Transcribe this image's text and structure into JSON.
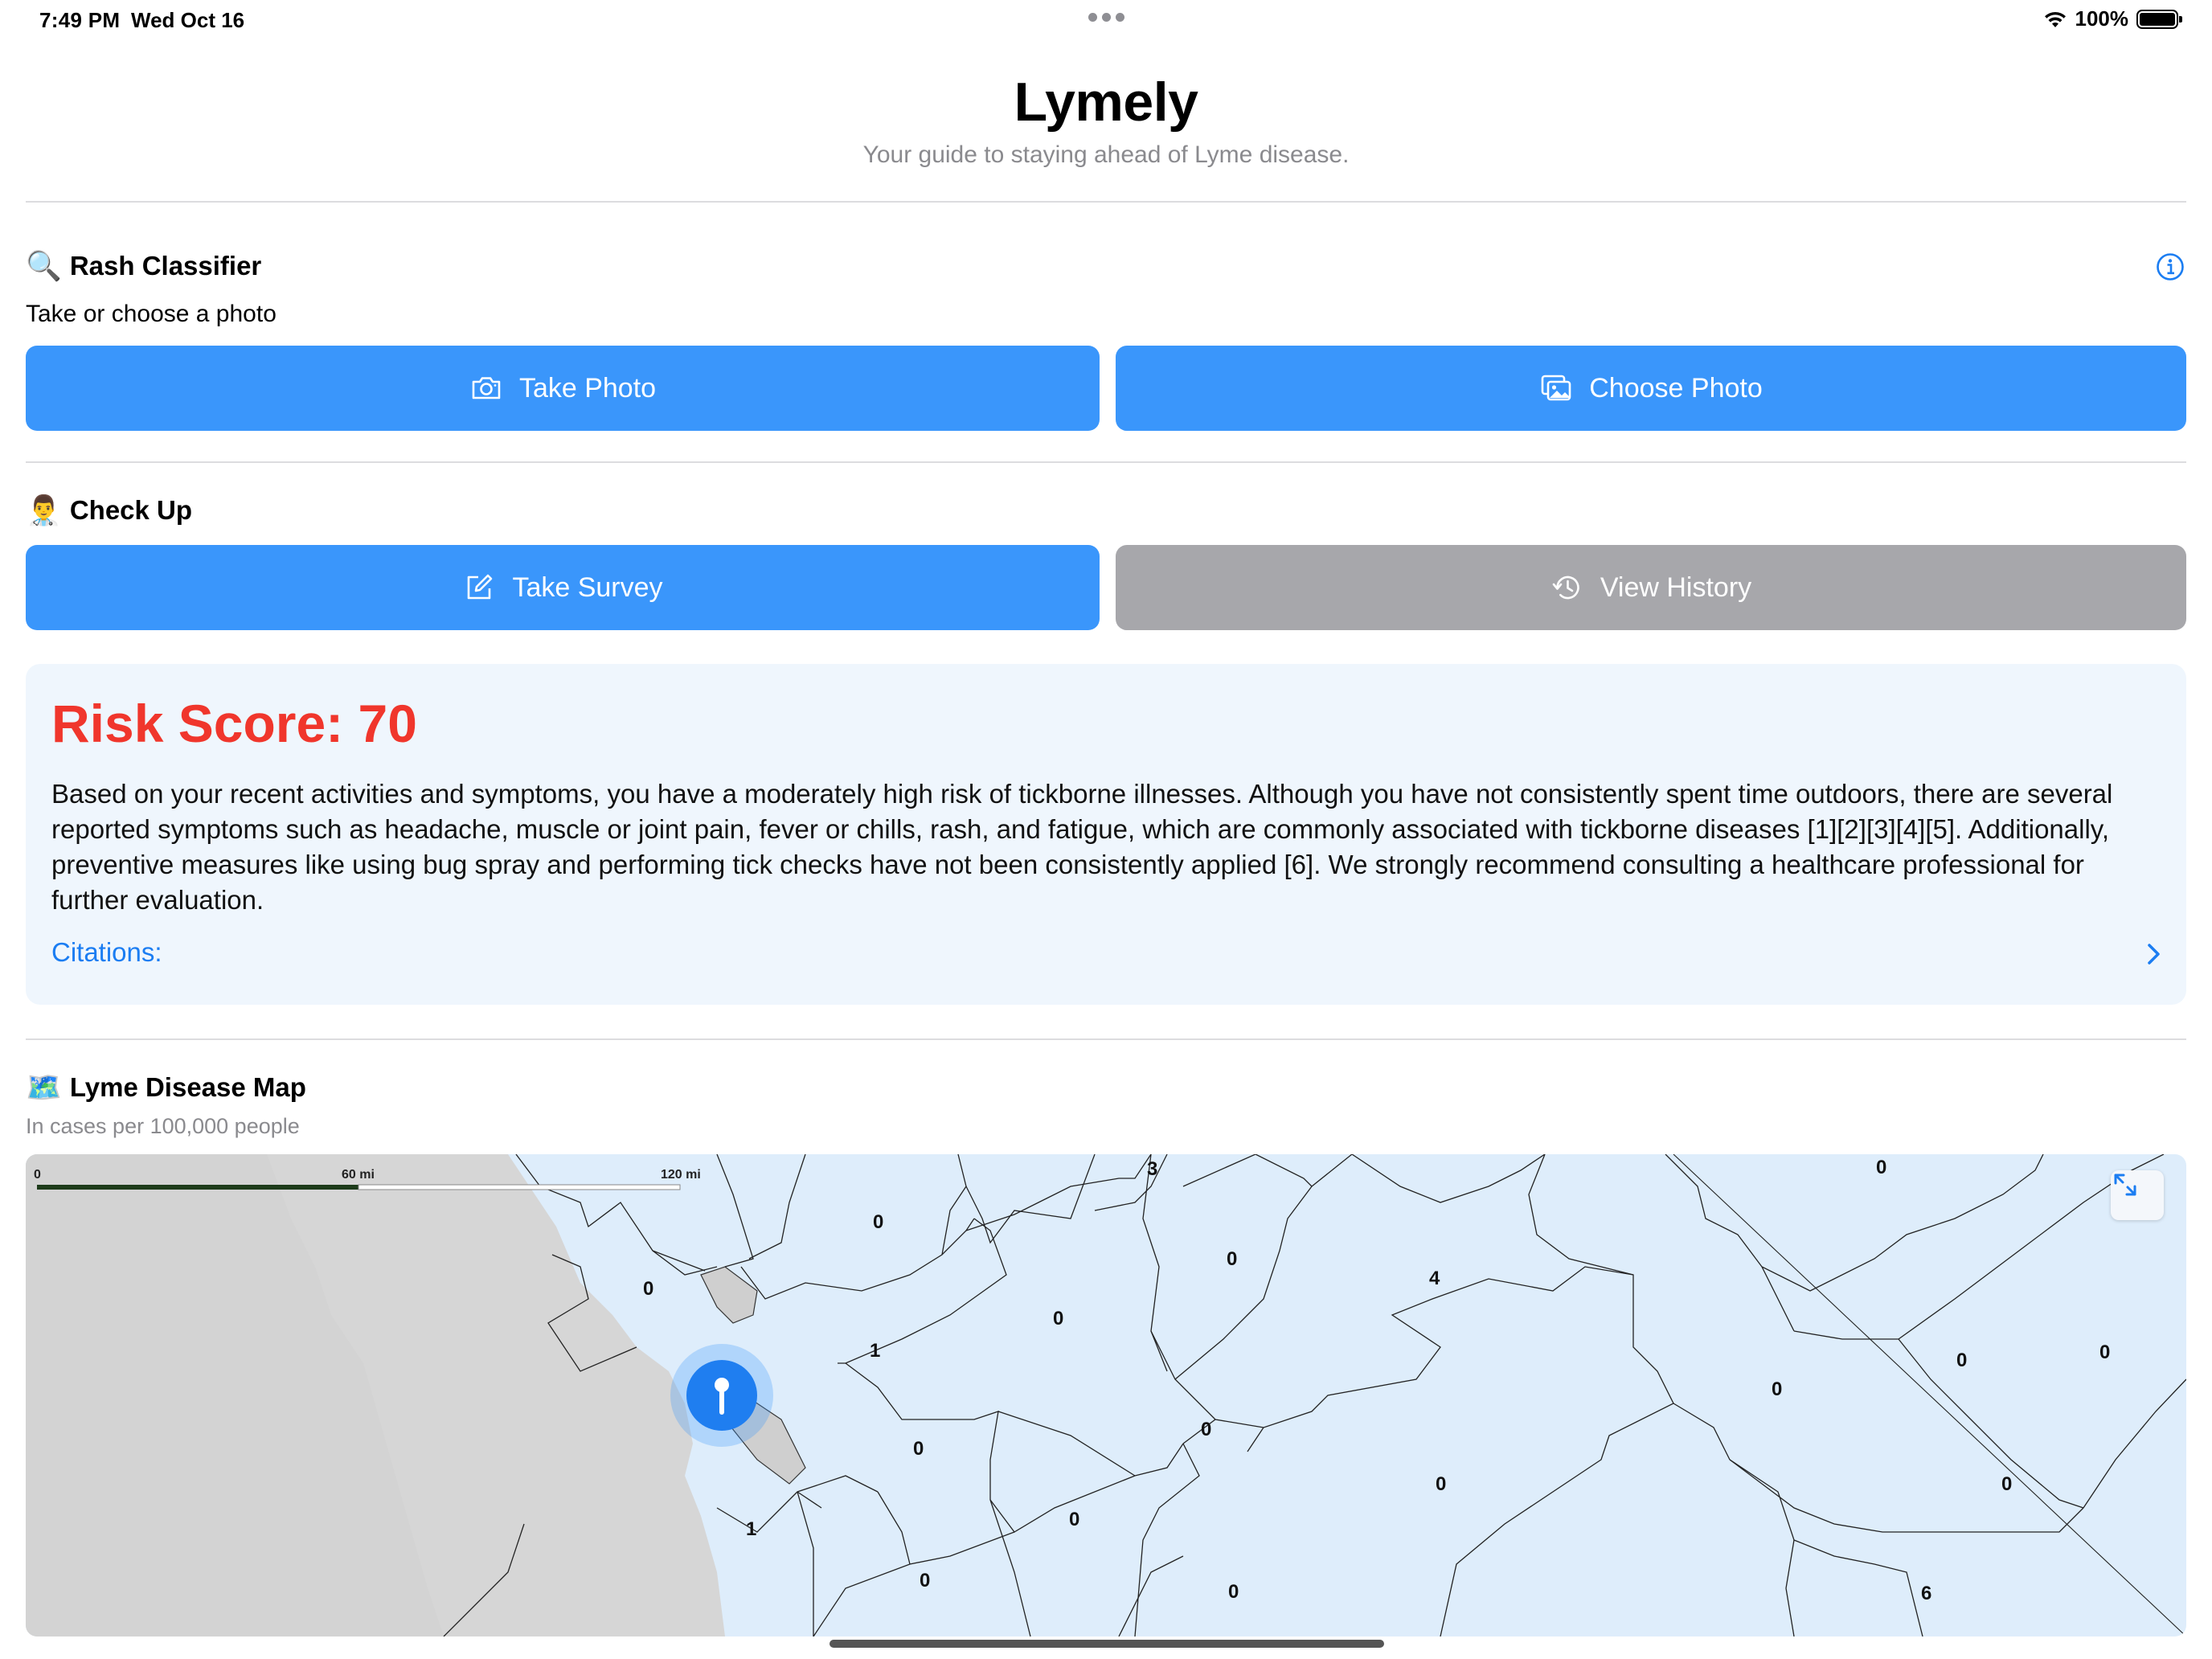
{
  "status_bar": {
    "time": "7:49 PM",
    "date": "Wed Oct 16",
    "battery": "100%"
  },
  "header": {
    "title": "Lymely",
    "subtitle": "Your guide to staying ahead of Lyme disease."
  },
  "rash_classifier": {
    "emoji": "🔍",
    "title": "Rash Classifier",
    "prompt": "Take or choose a photo",
    "take_photo_label": "Take Photo",
    "choose_photo_label": "Choose Photo"
  },
  "check_up": {
    "emoji": "👨‍⚕️",
    "title": "Check Up",
    "take_survey_label": "Take Survey",
    "view_history_label": "View History"
  },
  "risk": {
    "title": "Risk Score: 70",
    "body": "Based on your recent activities and symptoms, you have a moderately high risk of tickborne illnesses. Although you have not consistently spent time outdoors, there are several reported symptoms such as headache, muscle or joint pain, fever or chills, rash, and fatigue, which are commonly associated with tickborne diseases [1][2][3][4][5]. Additionally, preventive measures like using bug spray and performing tick checks have not been consistently applied [6]. We strongly recommend consulting a healthcare professional for further evaluation.",
    "citations_label": "Citations:"
  },
  "map": {
    "emoji": "🗺️",
    "title": "Lyme Disease Map",
    "subtitle": "In cases per 100,000 people",
    "scale": {
      "zero": "0",
      "mid": "60 mi",
      "max": "120 mi"
    },
    "county_values": [
      "3",
      "0",
      "0",
      "0",
      "0",
      "1",
      "0",
      "0",
      "4",
      "0",
      "0",
      "0",
      "0",
      "0",
      "1",
      "0",
      "0",
      "0",
      "0",
      "6"
    ]
  },
  "colors": {
    "primary_blue": "#3a96fb",
    "disabled_gray": "#a7a7ab",
    "risk_red": "#f0362c",
    "link_blue": "#1b7df2",
    "card_bg": "#eff6fd",
    "map_fill": "#deedfb"
  },
  "icons": {
    "take_photo": "camera-icon",
    "choose_photo": "photo-library-icon",
    "take_survey": "square-pencil-icon",
    "view_history": "clock-history-icon",
    "info": "info-circle-icon",
    "citations": "chevron-right-icon",
    "expand_map": "expand-arrows-icon",
    "location": "location-pin-icon"
  }
}
